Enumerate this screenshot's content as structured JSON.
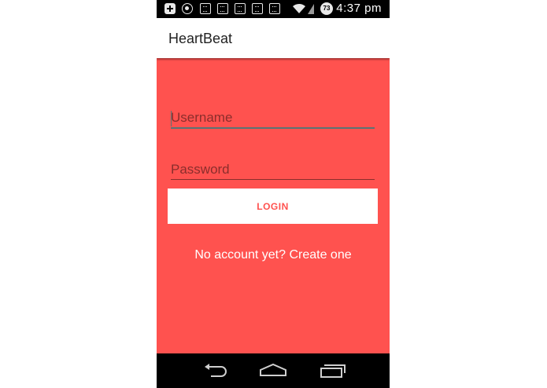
{
  "status_bar": {
    "time": "4:37  pm",
    "battery_level": "73",
    "icons": [
      "plus-icon",
      "whatsapp-icon",
      "notification-icon",
      "notification-icon",
      "notification-icon",
      "notification-icon",
      "notification-icon",
      "wifi-icon",
      "signal-icon",
      "battery-icon"
    ]
  },
  "app_bar": {
    "title": "HeartBeat"
  },
  "login_form": {
    "username_placeholder": "Username",
    "password_placeholder": "Password",
    "login_label": "LOGIN",
    "signup_text": "No account yet? Create one"
  },
  "nav_bar": {
    "buttons": [
      "back-icon",
      "home-icon",
      "recent-apps-icon"
    ]
  },
  "colors": {
    "accent": "#ff524f",
    "status_bar": "#000000",
    "nav_bar": "#000000",
    "app_bar": "#ffffff",
    "username_underline": "#5a7474",
    "password_underline": "#8a2e2c"
  }
}
